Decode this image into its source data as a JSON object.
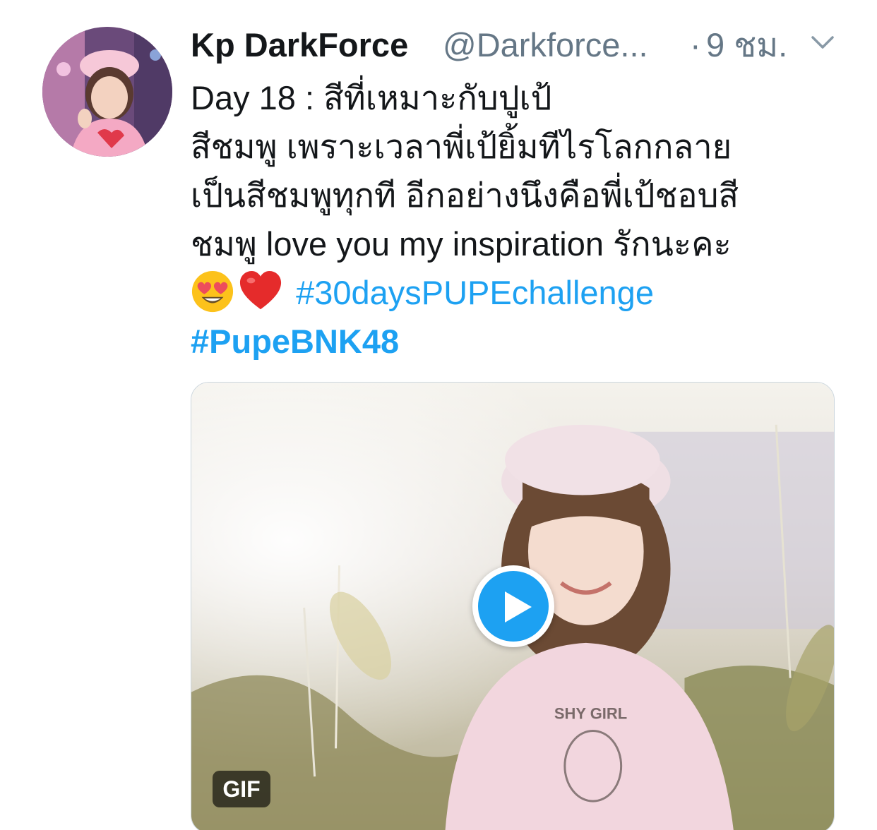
{
  "tweet": {
    "display_name": "Kp DarkForce",
    "handle": "@Darkforce...",
    "separator": "·",
    "time": "9 ชม.",
    "text_lines": [
      "Day 18 : สีที่เหมาะกับปูเป้",
      "สีชมพู เพราะเวลาพี่เป้ยิ้มทีไรโลกกลาย",
      "เป็นสีชมพูทุกที อีกอย่างนึงคือพี่เป้ชอบสี",
      "ชมพู love you my inspiration รักนะคะ"
    ],
    "emojis": [
      "smiling-face-with-heart-eyes",
      "red-heart"
    ],
    "hashtags": [
      "#30daysPUPEchallenge",
      "#PupeBNK48"
    ],
    "media": {
      "type": "gif",
      "badge_label": "GIF",
      "shirt_text": "SHY GIRL"
    }
  },
  "colors": {
    "link": "#1da1f2",
    "secondary_text": "#657786",
    "primary_text": "#14171a"
  }
}
